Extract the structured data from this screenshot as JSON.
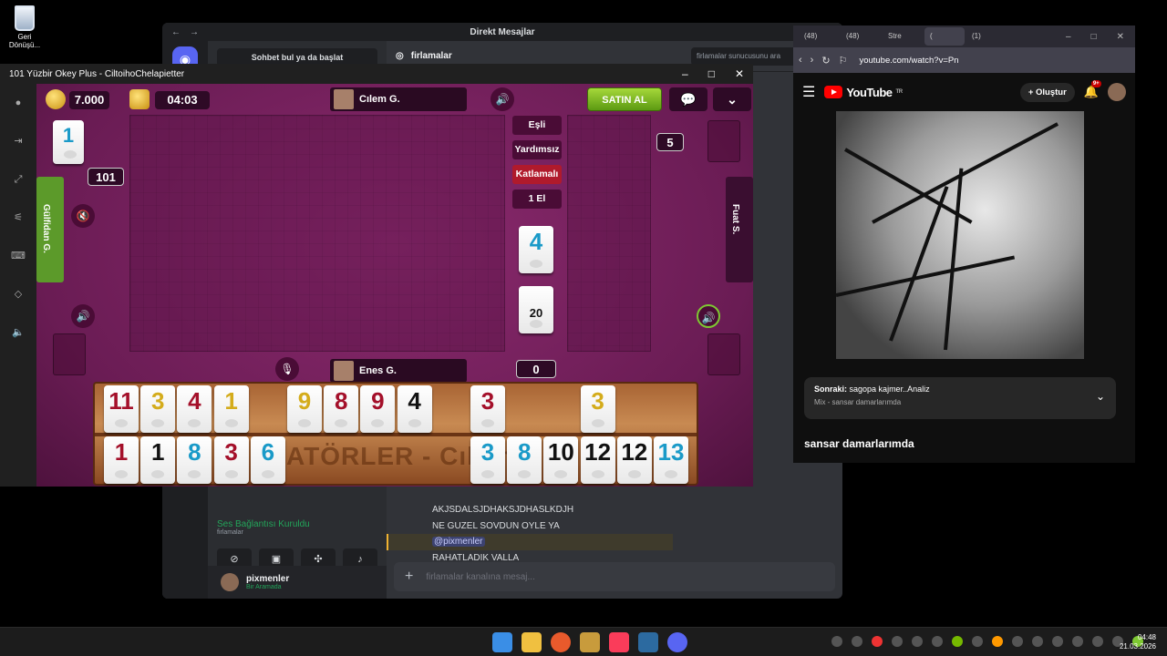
{
  "desktop": {
    "recycle_label": "Geri Dönüşü..."
  },
  "discord": {
    "title": "Direkt Mesajlar",
    "find_placeholder": "Sohbet bul ya da başlat",
    "channel": "firlamalar",
    "search_placeholder": "firlamalar sunucusunu ara",
    "messages": [
      "AKJSDALSJDHAKSJDHASLKDJH",
      "NE GUZEL SOVDUN OYLE YA",
      "@pixmenler",
      "RAHATLADIK VALLA"
    ],
    "voice_status": "Ses Bağlantısı Kuruldu",
    "voice_channel": "firlamalar",
    "user_name": "pixmenler",
    "user_status": "Bir Aramada",
    "input_placeholder": "firlamalar kanalına mesaj..."
  },
  "browser": {
    "tabs": [
      "(48)",
      "(48)",
      "Stre",
      "(",
      "(1)"
    ],
    "url": "youtube.com/watch?v=Pn",
    "logo": "YouTube",
    "logo_region": "TR",
    "create_label": "Oluştur",
    "bell_badge": "9+",
    "next_label": "Sonraki:",
    "next_title": "sagopa kajmer..Analiz",
    "next_sub": "Mix - sansar damarlarımda",
    "video_title": "sansar damarlarımda"
  },
  "game": {
    "window_title": "101 Yüzbir Okey Plus - CiltoihoChelapietter",
    "coins": "7.000",
    "timer": "04:03",
    "buy_label": "SATIN AL",
    "top_player": "Cılem G.",
    "bottom_player": "Enes G.",
    "left_player": "Gülfidan G.",
    "right_player": "Fuat S.",
    "opts": [
      "Eşli",
      "Yardımsız",
      "Katlamalı",
      "1 El"
    ],
    "score_top": "101",
    "right_count": "5",
    "bottom_count": "0",
    "indicator_tile": "1",
    "center_tile": "4",
    "deck_count": "20",
    "rack_watermark": "ATÖRLER - Cılem G.",
    "rack_row1": [
      {
        "n": "11",
        "c": "red"
      },
      {
        "n": "3",
        "c": "yel"
      },
      {
        "n": "4",
        "c": "red"
      },
      {
        "n": "1",
        "c": "yel"
      },
      {
        "n": "9",
        "c": "yel"
      },
      {
        "n": "8",
        "c": "red"
      },
      {
        "n": "9",
        "c": "red"
      },
      {
        "n": "4",
        "c": "blk"
      },
      {
        "n": "3",
        "c": "red"
      },
      {
        "n": "3",
        "c": "yel"
      }
    ],
    "rack_row2": [
      {
        "n": "1",
        "c": "red"
      },
      {
        "n": "1",
        "c": "blk"
      },
      {
        "n": "8",
        "c": "blu"
      },
      {
        "n": "3",
        "c": "red"
      },
      {
        "n": "6",
        "c": "blu"
      },
      {
        "n": "3",
        "c": "blu"
      },
      {
        "n": "8",
        "c": "blu"
      },
      {
        "n": "10",
        "c": "blk"
      },
      {
        "n": "12",
        "c": "blk"
      },
      {
        "n": "12",
        "c": "blk"
      },
      {
        "n": "13",
        "c": "blu"
      }
    ]
  },
  "taskbar": {
    "time": "04:48",
    "date": "21.03.2026"
  }
}
